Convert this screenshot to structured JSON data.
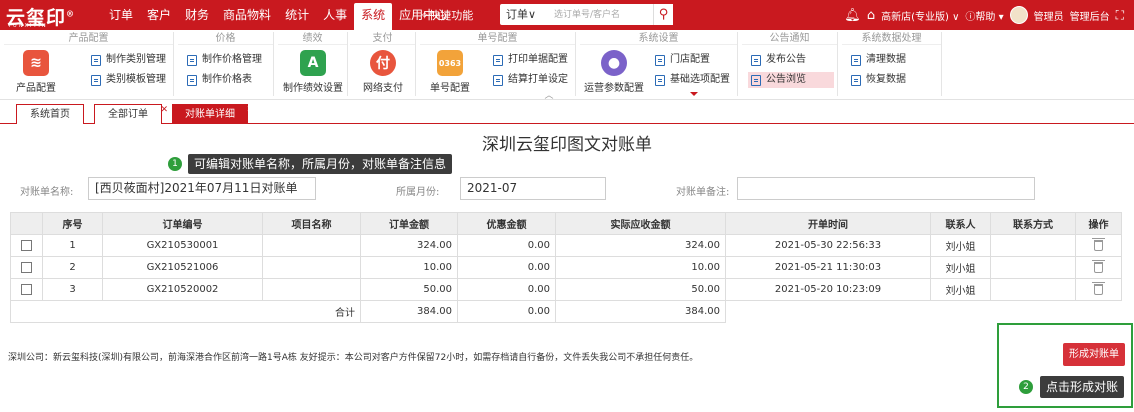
{
  "header": {
    "logo": "云玺印",
    "logo_mark": "®",
    "logo_sub": "YUNXIYIN",
    "nav": [
      "订单",
      "客户",
      "财务",
      "商品物料",
      "统计",
      "人事",
      "系统",
      "应用中心"
    ],
    "active_nav": "系统",
    "quick_label": "快捷功能",
    "order_select": "订单",
    "search_placeholder": "选订单号/客户名",
    "store": "高新店(专业版)",
    "help": "帮助",
    "user": "管理员",
    "admin_link": "管理后台"
  },
  "ribbon": {
    "groups": {
      "product": {
        "title": "产品配置",
        "big": "产品配置",
        "items": [
          "制作类别管理",
          "类别模板管理"
        ]
      },
      "price": {
        "title": "价格",
        "items": [
          "制作价格管理",
          "制作价格表"
        ]
      },
      "perf": {
        "title": "绩效",
        "big": "制作绩效设置"
      },
      "pay": {
        "title": "支付",
        "big": "网络支付"
      },
      "number": {
        "title": "单号配置",
        "big": "单号配置",
        "items": [
          "打印单据配置",
          "结算打单设定"
        ]
      },
      "sys": {
        "title": "系统设置",
        "big": "运营参数配置",
        "items": [
          "门店配置",
          "基础选项配置"
        ]
      },
      "notice": {
        "title": "公告通知",
        "items": [
          "发布公告",
          "公告浏览"
        ]
      },
      "dataproc": {
        "title": "系统数据处理",
        "items": [
          "清理数据",
          "恢复数据"
        ]
      }
    }
  },
  "tabs": [
    "系统首页",
    "全部订单",
    "对账单详细"
  ],
  "page": {
    "title": "深圳云玺印图文对账单",
    "tip1_badge": "1",
    "tip1": "可编辑对账单名称，所属月份，对账单备注信息",
    "name_label": "对账单名称:",
    "name_value": "[西贝莜面村]2021年07月11日对账单",
    "month_label": "所属月份:",
    "month_value": "2021-07",
    "remark_label": "对账单备注:",
    "remark_value": ""
  },
  "table": {
    "headers": [
      "",
      "序号",
      "订单编号",
      "项目名称",
      "订单金额",
      "优惠金额",
      "实际应收金额",
      "开单时间",
      "联系人",
      "联系方式",
      "操作"
    ],
    "rows": [
      {
        "seq": "1",
        "order": "GX210530001",
        "project": "",
        "amount": "324.00",
        "discount": "0.00",
        "actual": "324.00",
        "time": "2021-05-30 22:56:33",
        "contact": "刘小姐",
        "phone": ""
      },
      {
        "seq": "2",
        "order": "GX210521006",
        "project": "",
        "amount": "10.00",
        "discount": "0.00",
        "actual": "10.00",
        "time": "2021-05-21 11:30:03",
        "contact": "刘小姐",
        "phone": ""
      },
      {
        "seq": "3",
        "order": "GX210520002",
        "project": "",
        "amount": "50.00",
        "discount": "0.00",
        "actual": "50.00",
        "time": "2021-05-20 10:23:09",
        "contact": "刘小姐",
        "phone": ""
      }
    ],
    "total_label": "合计",
    "total_amount": "384.00",
    "total_discount": "0.00",
    "total_actual": "384.00"
  },
  "footer": "深圳公司：新云玺科技(深圳)有限公司，前海深港合作区前湾一路1号A栋 友好提示：本公司对客户方件保留72小时，如需存档请自行备份，文件丢失我公司不承担任何责任。",
  "actions": {
    "form_button": "形成对账单",
    "tip2_badge": "2",
    "tip2": "点击形成对账"
  },
  "colors": {
    "brand": "#c9191f",
    "accent_green": "#2e9e3b",
    "button": "#d63139"
  }
}
